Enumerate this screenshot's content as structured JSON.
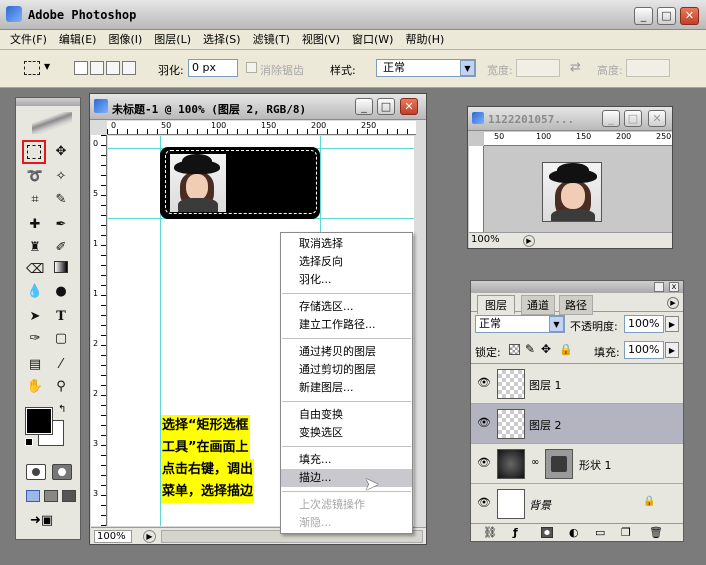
{
  "app": {
    "title": "Adobe Photoshop",
    "controls": {
      "min": "_",
      "max": "□",
      "close": "✕"
    }
  },
  "menubar": [
    "文件(F)",
    "编辑(E)",
    "图像(I)",
    "图层(L)",
    "选择(S)",
    "滤镜(T)",
    "视图(V)",
    "窗口(W)",
    "帮助(H)"
  ],
  "options": {
    "feather_label": "羽化:",
    "feather_value": "0 px",
    "antialias_label": "消除锯齿",
    "style_label": "样式:",
    "style_value": "正常",
    "width_label": "宽度:",
    "height_label": "高度:"
  },
  "doc": {
    "title": "未标题-1 @ 100% (图层 2, RGB/8)",
    "zoom": "100%",
    "ruler_h": [
      "0",
      "50",
      "100",
      "150",
      "200",
      "250"
    ],
    "ruler_v": [
      "0",
      "5",
      "1",
      "1",
      "2",
      "2",
      "3",
      "3"
    ]
  },
  "nav": {
    "title": "1122201057...",
    "zoom": "100%",
    "ruler_h": [
      "50",
      "100",
      "150",
      "200",
      "250"
    ]
  },
  "context_menu": {
    "items": [
      {
        "label": "取消选择",
        "state": "normal"
      },
      {
        "label": "选择反向",
        "state": "normal"
      },
      {
        "label": "羽化...",
        "state": "normal"
      },
      {
        "sep": true
      },
      {
        "label": "存储选区...",
        "state": "normal"
      },
      {
        "label": "建立工作路径...",
        "state": "normal"
      },
      {
        "sep": true
      },
      {
        "label": "通过拷贝的图层",
        "state": "normal"
      },
      {
        "label": "通过剪切的图层",
        "state": "normal"
      },
      {
        "label": "新建图层...",
        "state": "normal"
      },
      {
        "sep": true
      },
      {
        "label": "自由变换",
        "state": "normal"
      },
      {
        "label": "变换选区",
        "state": "normal"
      },
      {
        "sep": true
      },
      {
        "label": "填充...",
        "state": "normal"
      },
      {
        "label": "描边...",
        "state": "selected"
      },
      {
        "sep": true
      },
      {
        "label": "上次滤镜操作",
        "state": "disabled"
      },
      {
        "label": "渐隐...",
        "state": "disabled"
      }
    ]
  },
  "annotation": [
    "选择“矩形选框",
    "工具”在画面上",
    "点击右键，调出",
    "菜单，选择描边"
  ],
  "layers": {
    "tabs": [
      "图层",
      "通道",
      "路径"
    ],
    "blend_mode": "正常",
    "opacity_label": "不透明度:",
    "opacity_value": "100%",
    "lock_label": "锁定:",
    "fill_label": "填充:",
    "fill_value": "100%",
    "items": [
      {
        "name": "图层 1",
        "active": false
      },
      {
        "name": "图层 2",
        "active": true
      },
      {
        "name": "形状 1",
        "active": false
      },
      {
        "name": "背景",
        "active": false
      }
    ]
  },
  "colors": {
    "selection_highlight": "#e01b1b",
    "annotation_bg": "#ffff00",
    "guide": "#5fd7d7",
    "titlebar_close": "#c0402a"
  }
}
